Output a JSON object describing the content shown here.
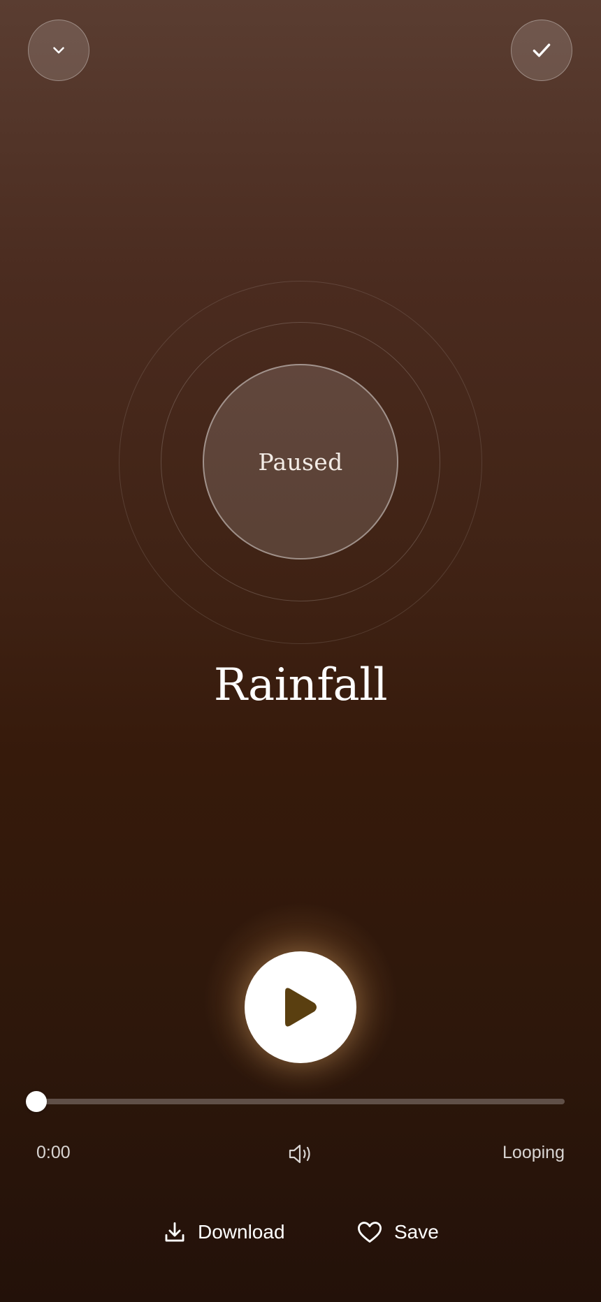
{
  "header": {
    "collapse_icon": "chevron-down-icon",
    "done_icon": "check-icon"
  },
  "visualizer": {
    "status": "Paused"
  },
  "track": {
    "title": "Rainfall"
  },
  "player": {
    "play_icon": "play-icon",
    "progress_fraction": 0.0,
    "elapsed": "0:00",
    "volume_icon": "volume-icon",
    "loop_label": "Looping"
  },
  "actions": {
    "download_label": "Download",
    "download_icon": "download-icon",
    "save_label": "Save",
    "save_icon": "heart-icon"
  },
  "colors": {
    "play_triangle": "#5a3f10"
  }
}
